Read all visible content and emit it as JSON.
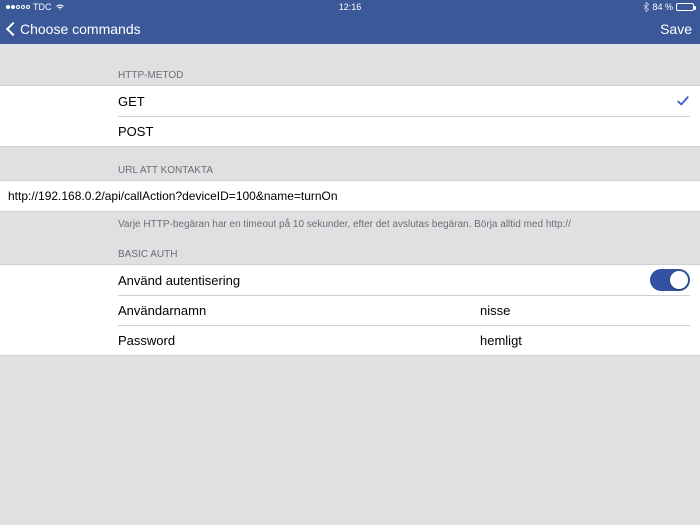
{
  "status": {
    "carrier": "TDC",
    "time": "12:16",
    "battery_pct": "84 %"
  },
  "nav": {
    "back_label": "Choose commands",
    "save_label": "Save"
  },
  "sections": {
    "http_method": {
      "header": "HTTP-METOD",
      "options": [
        "GET",
        "POST"
      ],
      "selected": "GET"
    },
    "url": {
      "header": "URL ATT KONTAKTA",
      "value": "http://192.168.0.2/api/callAction?deviceID=100&name=turnOn",
      "footer": "Varje HTTP-begäran har en timeout på 10 sekunder, efter det avslutas begäran. Börja alltid med http://"
    },
    "auth": {
      "header": "BASIC AUTH",
      "use_label": "Använd autentisering",
      "use_enabled": true,
      "username_label": "Användarnamn",
      "username_value": "nisse",
      "password_label": "Password",
      "password_value": "hemligt"
    }
  }
}
